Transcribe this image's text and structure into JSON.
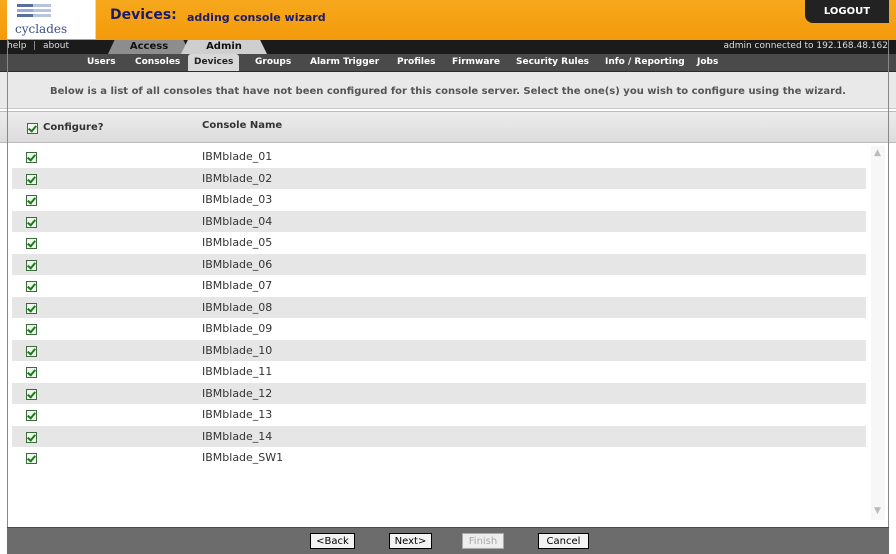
{
  "brand": {
    "name": "cyclades"
  },
  "header": {
    "title": "Devices:",
    "subtitle": "adding console wizard",
    "logout": "LOGOUT"
  },
  "topbar": {
    "help": "help",
    "separator": "|",
    "about": "about",
    "tabs": [
      "Access",
      "Admin"
    ],
    "active_tab": "Admin",
    "connection": "admin connected to 192.168.48.162"
  },
  "subnav": {
    "items": [
      "Users",
      "Consoles",
      "Devices",
      "Groups",
      "Alarm Trigger",
      "Profiles",
      "Firmware",
      "Security Rules",
      "Info / Reporting",
      "Jobs"
    ],
    "active": "Devices"
  },
  "instructions": "Below is a list of all consoles that have not been configured for this console server. Select the one(s) you wish to configure using the wizard.",
  "table": {
    "headers": {
      "configure": "Configure?",
      "name": "Console Name"
    },
    "header_checked": true,
    "rows": [
      {
        "name": "IBMblade_01",
        "checked": true
      },
      {
        "name": "IBMblade_02",
        "checked": true
      },
      {
        "name": "IBMblade_03",
        "checked": true
      },
      {
        "name": "IBMblade_04",
        "checked": true
      },
      {
        "name": "IBMblade_05",
        "checked": true
      },
      {
        "name": "IBMblade_06",
        "checked": true
      },
      {
        "name": "IBMblade_07",
        "checked": true
      },
      {
        "name": "IBMblade_08",
        "checked": true
      },
      {
        "name": "IBMblade_09",
        "checked": true
      },
      {
        "name": "IBMblade_10",
        "checked": true
      },
      {
        "name": "IBMblade_11",
        "checked": true
      },
      {
        "name": "IBMblade_12",
        "checked": true
      },
      {
        "name": "IBMblade_13",
        "checked": true
      },
      {
        "name": "IBMblade_14",
        "checked": true
      },
      {
        "name": "IBMblade_SW1",
        "checked": true
      }
    ]
  },
  "footer": {
    "back": "<Back",
    "next": "Next>",
    "finish": "Finish",
    "cancel": "Cancel"
  },
  "colors": {
    "header_orange": "#f7a81c",
    "title_navy": "#1b1b6a",
    "row_alt": "#e6e6e6",
    "check_green": "#1a7a1a"
  }
}
